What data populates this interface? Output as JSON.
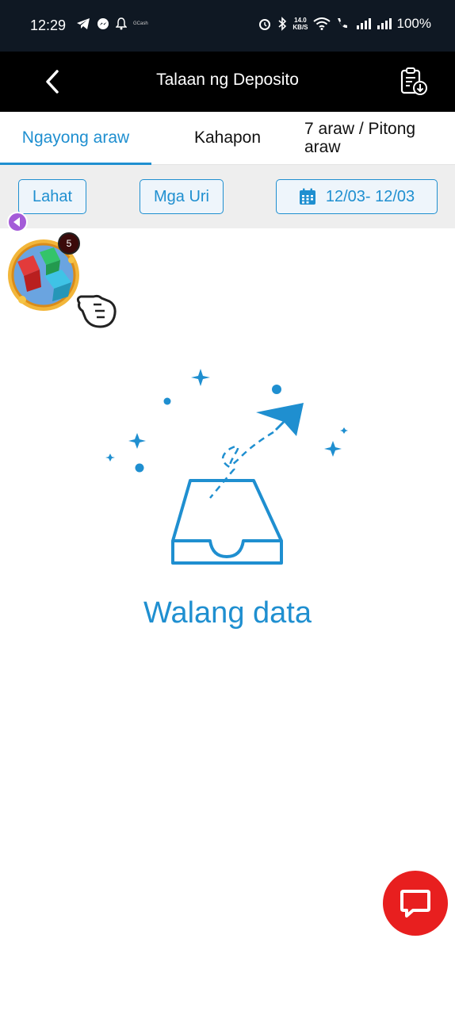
{
  "status_bar": {
    "time": "12:29",
    "gcash_label": "GCash",
    "net_speed_value": "14.0",
    "net_speed_unit": "KB/S",
    "battery": "100%"
  },
  "header": {
    "title": "Talaan ng Deposito",
    "back_icon": "chevron-left-icon",
    "history_icon": "clipboard-download-icon"
  },
  "tabs": [
    {
      "label": "Ngayong araw",
      "active": true
    },
    {
      "label": "Kahapon",
      "active": false
    },
    {
      "label": "7 araw / Pitong araw",
      "active": false
    }
  ],
  "filters": {
    "all_label": "Lahat",
    "types_label": "Mga Uri",
    "date_range": "12/03- 12/03"
  },
  "promo": {
    "badge_count": "5"
  },
  "empty_state": {
    "text": "Walang data"
  },
  "colors": {
    "accent": "#1f8fd0",
    "header_bg": "#000000",
    "status_bg": "#0f1823",
    "chat_bg": "#e81f1f"
  }
}
